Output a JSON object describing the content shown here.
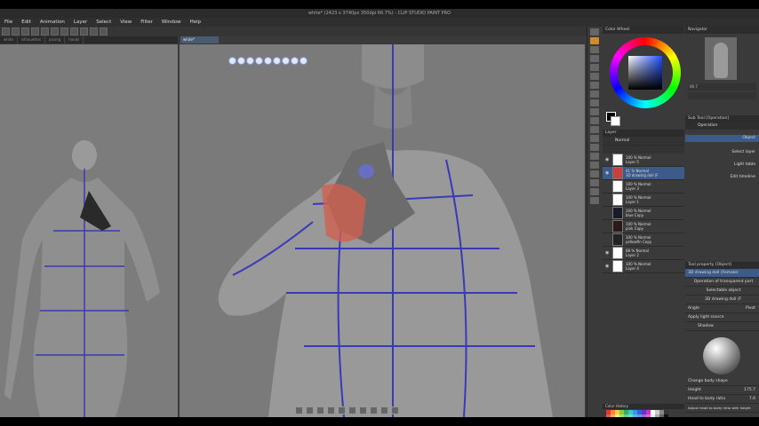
{
  "window_title": "white* (2423 x 3740px 350dpi 66.7%) - CLIP STUDIO PAINT PRO",
  "menu": [
    "File",
    "Edit",
    "Animation",
    "Layer",
    "Select",
    "View",
    "Filter",
    "Window",
    "Help"
  ],
  "left_tabs": [
    "white",
    "silhouettes",
    "posing",
    "hands"
  ],
  "right_tab": "white*",
  "color_panel": {
    "title": "Color Wheel"
  },
  "navigator": {
    "title": "Navigator",
    "zoom": "66.7"
  },
  "subtool": {
    "title": "Sub Tool [Operation]",
    "group": "Operation",
    "selected": "Object",
    "items": [
      "Select layer",
      "Light table",
      "Edit timeline"
    ]
  },
  "layer_panel": {
    "title": "Layer",
    "blend_mode": "Normal",
    "layers": [
      {
        "percent": "100 %",
        "mode": "Normal",
        "name": "Layer 5",
        "thumb": "#ffffff",
        "visible": true,
        "selected": false
      },
      {
        "percent": "61 %",
        "mode": "Normal",
        "name": "3D drawing doll (F",
        "thumb": "#c84040",
        "visible": true,
        "selected": true
      },
      {
        "percent": "100 %",
        "mode": "Normal",
        "name": "Layer 3",
        "thumb": "#ffffff",
        "visible": false,
        "selected": false
      },
      {
        "percent": "100 %",
        "mode": "Normal",
        "name": "Layer 1",
        "thumb": "#ffffff",
        "visible": false,
        "selected": false
      },
      {
        "percent": "100 %",
        "mode": "Normal",
        "name": "blue Copy",
        "thumb": "#1a1a2a",
        "visible": false,
        "selected": false
      },
      {
        "percent": "100 %",
        "mode": "Normal",
        "name": "pink Copy",
        "thumb": "#2a1a1a",
        "visible": false,
        "selected": false
      },
      {
        "percent": "100 %",
        "mode": "Normal",
        "name": "yellowfin Copy",
        "thumb": "#222222",
        "visible": false,
        "selected": false
      },
      {
        "percent": "68 %",
        "mode": "Normal",
        "name": "Layer 2",
        "thumb": "#ffffff",
        "visible": true,
        "selected": false
      },
      {
        "percent": "100 %",
        "mode": "Normal",
        "name": "Layer 4",
        "thumb": "#ffffff",
        "visible": true,
        "selected": false
      }
    ]
  },
  "tool_property": {
    "title": "Tool property [Object]",
    "subtitle": "3D drawing doll (Female)",
    "rows": [
      "Operation of transparent part",
      "Selectable object",
      "3D drawing doll (F"
    ],
    "angle_label": "Angle",
    "angle_value": "Pivot",
    "light_label": "Apply light source",
    "shadow_label": "Shadow",
    "body_shape_label": "Change body shape",
    "height_label": "Height",
    "height_value": "175.7",
    "head_ratio_label": "Head to body ratio",
    "head_ratio_value": "7.6",
    "adjust_label": "Adjust head to body ratio with height"
  },
  "color_history": {
    "title": "Color History"
  },
  "palette": [
    "#e33",
    "#f83",
    "#fc3",
    "#8c3",
    "#3a6",
    "#3cc",
    "#39e",
    "#36c",
    "#63c",
    "#c3c",
    "#fff",
    "#ccc",
    "#888",
    "#333",
    "#c66",
    "#fa6",
    "#ee9",
    "#ad6",
    "#6c9",
    "#6dd",
    "#6ae",
    "#69d",
    "#96d",
    "#d6c",
    "#eee",
    "#aaa",
    "#666",
    "#111"
  ]
}
